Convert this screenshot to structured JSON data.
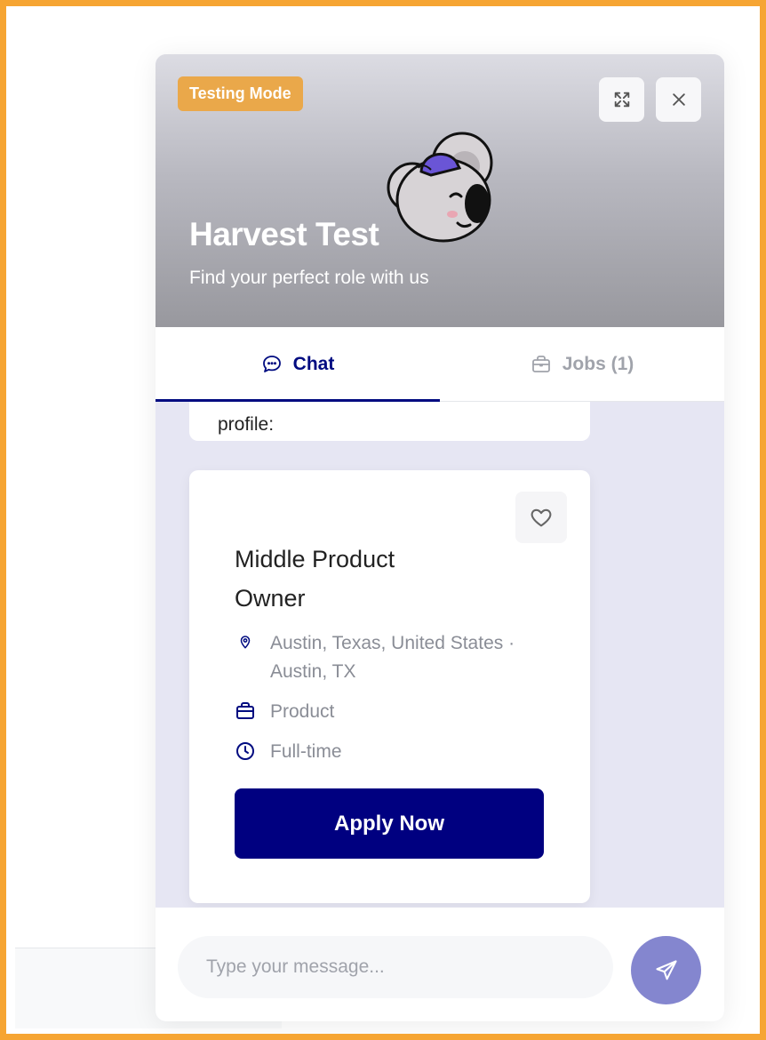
{
  "header": {
    "badge": "Testing Mode",
    "title": "Harvest Test",
    "subtitle": "Find your perfect role with us",
    "expand_icon": "expand-icon",
    "close_icon": "close-icon",
    "mascot": "koala-mascot"
  },
  "tabs": [
    {
      "label": "Chat",
      "icon": "chat-bubble-icon",
      "active": true
    },
    {
      "label": "Jobs (1)",
      "icon": "briefcase-icon",
      "active": false
    }
  ],
  "chat": {
    "previous_message_tail": "profile:"
  },
  "job": {
    "title": "Middle Product Owner",
    "location": "Austin, Texas, United States · Austin, TX",
    "department": "Product",
    "employment_type": "Full-time",
    "apply_label": "Apply Now",
    "favorite_icon": "heart-icon"
  },
  "composer": {
    "placeholder": "Type your message...",
    "value": "",
    "send_icon": "send-icon"
  },
  "colors": {
    "accent": "#000080",
    "badge": "#eaa84a",
    "send_button": "#8486cf",
    "frame": "#f6a533"
  }
}
